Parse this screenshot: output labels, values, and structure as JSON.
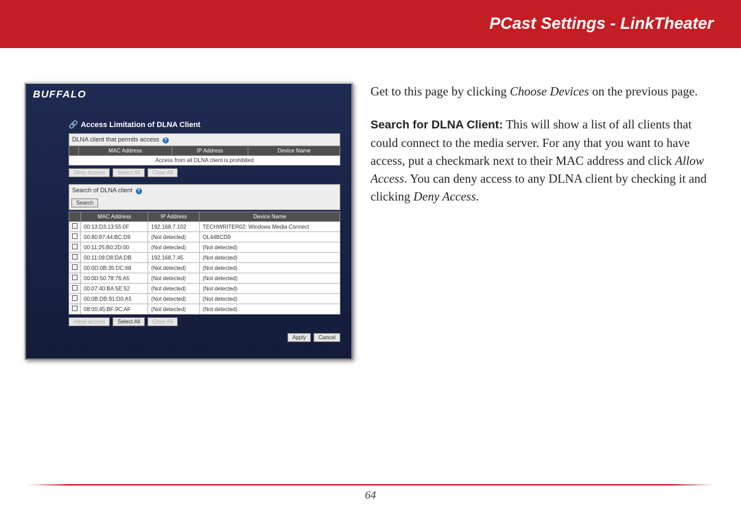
{
  "header": {
    "title": "PCast Settings - LinkTheater"
  },
  "brand": "BUFFALO",
  "section_title": "Access Limitation of DLNA Client",
  "permit_subtitle": "DLNA client that permits access",
  "columns": {
    "mac": "MAC Address",
    "ip": "IP Address",
    "name": "Device Name"
  },
  "prohibited_note": "Access from all DLNA client is prohibited",
  "buttons": {
    "deny": "Deny Access",
    "select_all": "Select All",
    "clear_all": "Clear All",
    "allow": "Allow access",
    "search": "Search",
    "apply": "Apply",
    "cancel": "Cancel"
  },
  "search_subtitle": "Search of DLNA client",
  "search_rows": [
    {
      "mac": "00:13:D3:13:55:0F",
      "ip": "192.168.7.102",
      "name": "TECHWRITER02: Windows Media Connect"
    },
    {
      "mac": "00:80:87:44:BC:D9",
      "ip": "(Not detected)",
      "name": "OL44BCD9"
    },
    {
      "mac": "00:11:25:B0:2D:00",
      "ip": "(Not detected)",
      "name": "(Not detected)"
    },
    {
      "mac": "00:11:09:D8:DA:DB",
      "ip": "192.168.7.45",
      "name": "(Not detected)"
    },
    {
      "mac": "00:0D:0B:35:DC:68",
      "ip": "(Not detected)",
      "name": "(Not detected)"
    },
    {
      "mac": "00:0D:50:78:76:A5",
      "ip": "(Not detected)",
      "name": "(Not detected)"
    },
    {
      "mac": "00:07:40:BA:5E:52",
      "ip": "(Not detected)",
      "name": "(Not detected)"
    },
    {
      "mac": "00:0B:DB:91:D0:A5",
      "ip": "(Not detected)",
      "name": "(Not detected)"
    },
    {
      "mac": "08:00:45:BF:9C:AF",
      "ip": "(Not detected)",
      "name": "(Not detected)"
    }
  ],
  "explain": {
    "p1_a": "Get to this page by clicking ",
    "p1_em": "Choose Devices",
    "p1_b": " on the previous page.",
    "p2_bold": "Search for DLNA Client:",
    "p2_a": "  This will show a list of all clients that could connect to the media server.  For any that you want to have access, put a checkmark next to their MAC address and click ",
    "p2_em1": "Allow Access",
    "p2_b": ".  You can deny access to any DLNA client by checking it and clicking ",
    "p2_em2": "Deny Access",
    "p2_c": "."
  },
  "page_number": "64"
}
